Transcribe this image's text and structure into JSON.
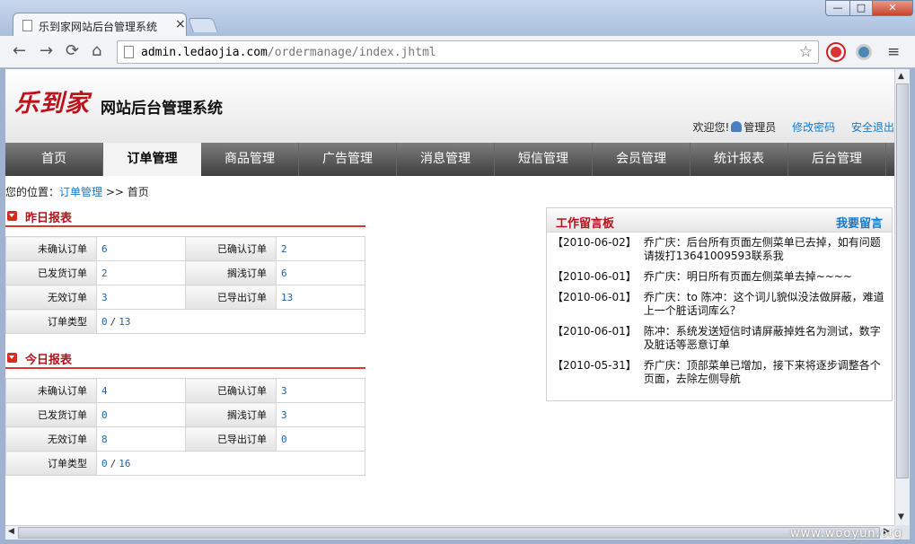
{
  "browser": {
    "tab_title": "乐到家网站后台管理系统",
    "tab_close": "×",
    "url_host": "admin.ledaojia.com",
    "url_path": "/ordermanage/index.jhtml",
    "win_min": "—",
    "win_max": "□",
    "win_close": "✕",
    "back": "←",
    "forward": "→",
    "reload": "⟳",
    "home": "⌂",
    "star": "☆",
    "menu": "≡"
  },
  "header": {
    "logo": "乐到家",
    "subtitle": "网站后台管理系统",
    "welcome": "欢迎您!",
    "username": "管理员",
    "change_password": "修改密码",
    "logout": "安全退出"
  },
  "nav": {
    "items": [
      "首页",
      "订单管理",
      "商品管理",
      "广告管理",
      "消息管理",
      "短信管理",
      "会员管理",
      "统计报表",
      "后台管理"
    ],
    "active_index": 1
  },
  "breadcrumb": {
    "prefix": "您的位置：",
    "link": "订单管理",
    "sep": ">>",
    "current": "首页"
  },
  "yesterday": {
    "title": "昨日报表",
    "rows": [
      {
        "l1": "未确认订单",
        "v1": "6",
        "l2": "已确认订单",
        "v2": "2"
      },
      {
        "l1": "已发货订单",
        "v1": "2",
        "l2": "搁浅订单",
        "v2": "6"
      },
      {
        "l1": "无效订单",
        "v1": "3",
        "l2": "已导出订单",
        "v2": "13"
      }
    ],
    "type_label": "订单类型",
    "type_a": "0",
    "type_sep": "/",
    "type_b": "13"
  },
  "today": {
    "title": "今日报表",
    "rows": [
      {
        "l1": "未确认订单",
        "v1": "4",
        "l2": "已确认订单",
        "v2": "3"
      },
      {
        "l1": "已发货订单",
        "v1": "0",
        "l2": "搁浅订单",
        "v2": "3"
      },
      {
        "l1": "无效订单",
        "v1": "8",
        "l2": "已导出订单",
        "v2": "0"
      }
    ],
    "type_label": "订单类型",
    "type_a": "0",
    "type_sep": "/",
    "type_b": "16"
  },
  "board": {
    "title": "工作留言板",
    "action": "我要留言",
    "messages": [
      {
        "date": "【2010-06-02】",
        "text": "乔广庆：后台所有页面左侧菜单已去掉，如有问题请拨打13641009593联系我"
      },
      {
        "date": "【2010-06-01】",
        "text": "乔广庆：明日所有页面左侧菜单去掉~~~~"
      },
      {
        "date": "【2010-06-01】",
        "text": "乔广庆：to 陈冲：这个词儿貌似没法做屏蔽，难道上一个脏话词库么？"
      },
      {
        "date": "【2010-06-01】",
        "text": "陈冲：系统发送短信时请屏蔽掉姓名为测试，数字及脏话等恶意订单"
      },
      {
        "date": "【2010-05-31】",
        "text": "乔广庆：顶部菜单已增加，接下来将逐步调整各个页面，去除左侧导航"
      }
    ]
  },
  "watermark": "www.wooyun.org"
}
